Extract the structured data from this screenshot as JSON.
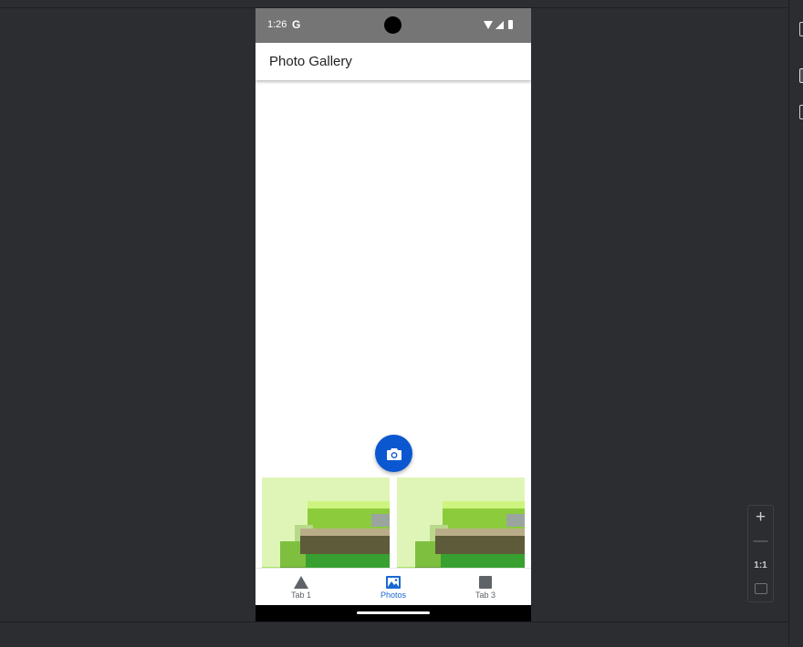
{
  "status_bar": {
    "time": "1:26",
    "carrier_icon": "G"
  },
  "app_bar": {
    "title": "Photo Gallery"
  },
  "fab": {
    "icon": "camera-icon",
    "color": "#0b57d0"
  },
  "photos": [
    {
      "icon": "house-pixel-art"
    },
    {
      "icon": "house-pixel-art"
    }
  ],
  "bottom_nav": {
    "items": [
      {
        "label": "Tab 1",
        "icon": "triangle-icon",
        "active": false
      },
      {
        "label": "Photos",
        "icon": "images-icon",
        "active": true
      },
      {
        "label": "Tab 3",
        "icon": "square-icon",
        "active": false
      }
    ],
    "active_color": "#1967d2"
  },
  "ide": {
    "zoom_controls": {
      "zoom_in": "+",
      "zoom_out": "—",
      "actual_size": "1:1"
    }
  }
}
